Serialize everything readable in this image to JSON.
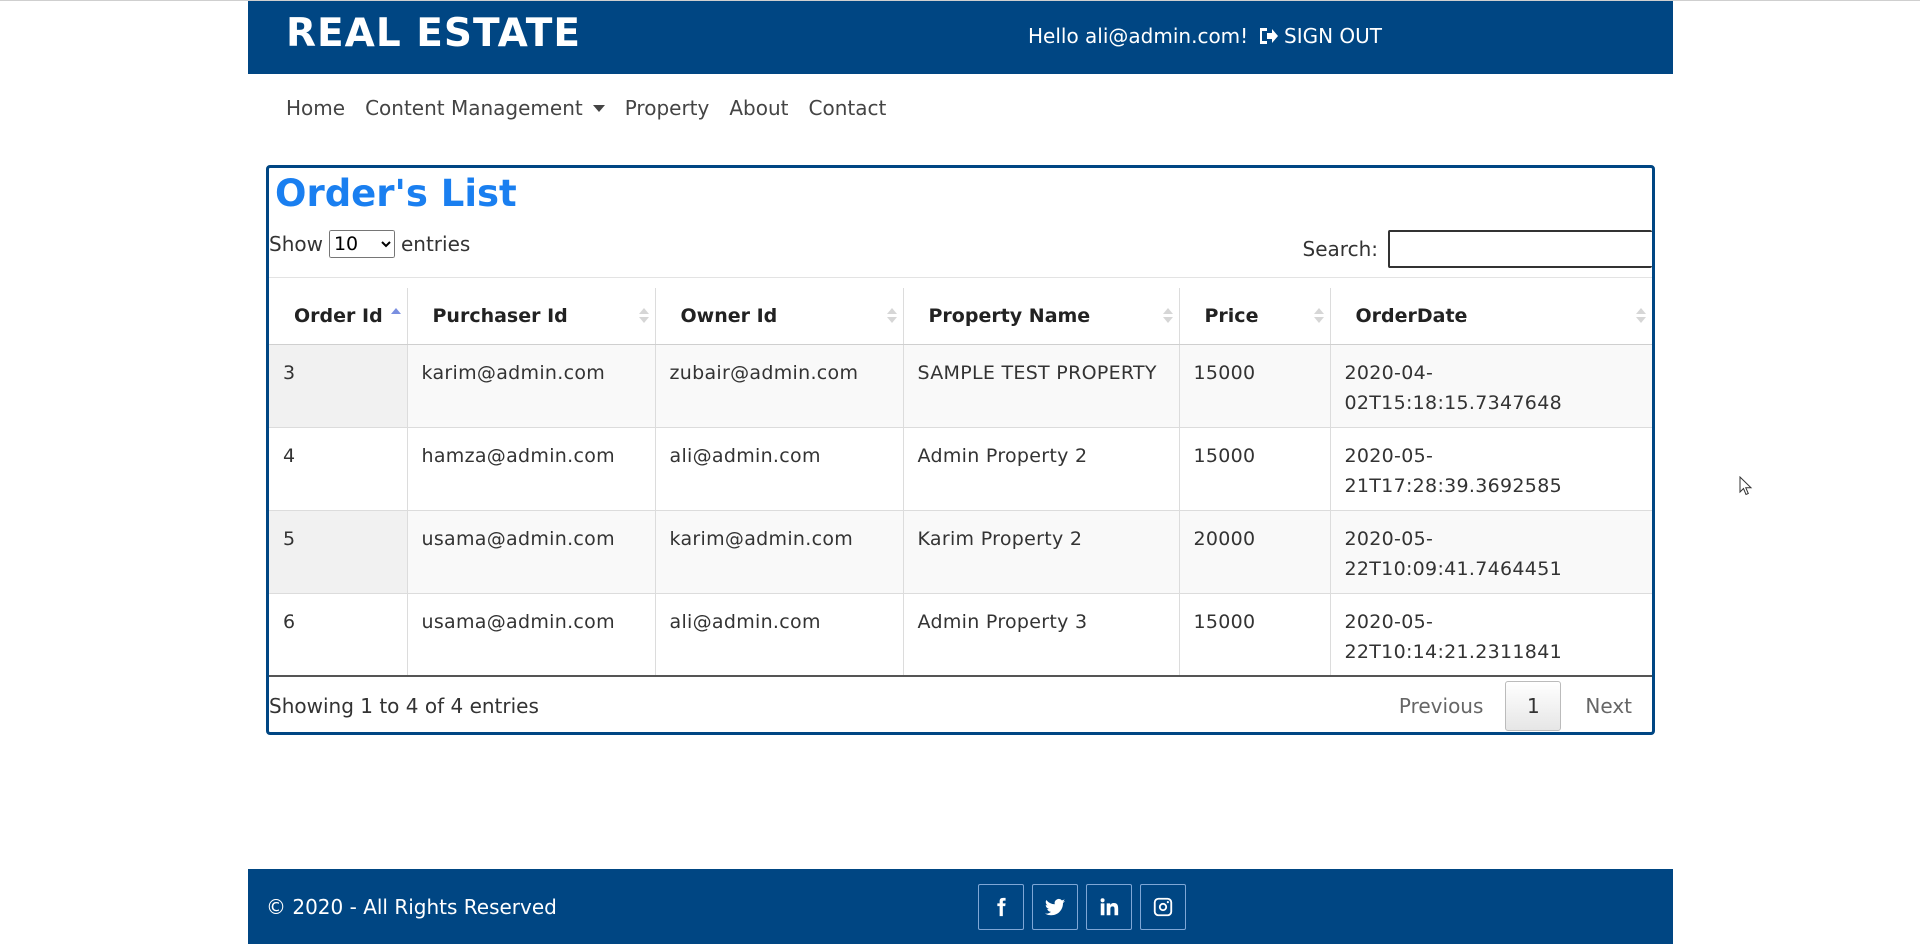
{
  "header": {
    "brand": "REAL ESTATE",
    "greeting": "Hello ali@admin.com!",
    "signout_label": "SIGN OUT"
  },
  "nav": {
    "items": [
      {
        "label": "Home"
      },
      {
        "label": "Content Management"
      },
      {
        "label": "Property"
      },
      {
        "label": "About"
      },
      {
        "label": "Contact"
      }
    ]
  },
  "orders": {
    "title": "Order's List",
    "show_label": "Show",
    "page_size": "10",
    "entries_label": "entries",
    "search_label": "Search:",
    "search_value": "",
    "columns": [
      "Order Id",
      "Purchaser Id",
      "Owner Id",
      "Property Name",
      "Price",
      "OrderDate"
    ],
    "sorted_column": "Order Id",
    "sort_direction": "ascending",
    "rows": [
      [
        "3",
        "karim@admin.com",
        "zubair@admin.com",
        "SAMPLE TEST PROPERTY",
        "15000",
        "2020-04-02T15:18:15.7347648"
      ],
      [
        "4",
        "hamza@admin.com",
        "ali@admin.com",
        "Admin Property 2",
        "15000",
        "2020-05-21T17:28:39.3692585"
      ],
      [
        "5",
        "usama@admin.com",
        "karim@admin.com",
        "Karim Property 2",
        "20000",
        "2020-05-22T10:09:41.7464451"
      ],
      [
        "6",
        "usama@admin.com",
        "ali@admin.com",
        "Admin Property 3",
        "15000",
        "2020-05-22T10:14:21.2311841"
      ]
    ],
    "info": "Showing 1 to 4 of 4 entries",
    "pagination": {
      "previous": "Previous",
      "current_page": "1",
      "next": "Next"
    }
  },
  "footer": {
    "copyright": "© 2020 - All Rights Reserved",
    "social": [
      "facebook-icon",
      "twitter-icon",
      "linkedin-icon",
      "instagram-icon"
    ]
  },
  "colors": {
    "brand_blue": "#004683",
    "title_blue": "#1a7ff0"
  }
}
